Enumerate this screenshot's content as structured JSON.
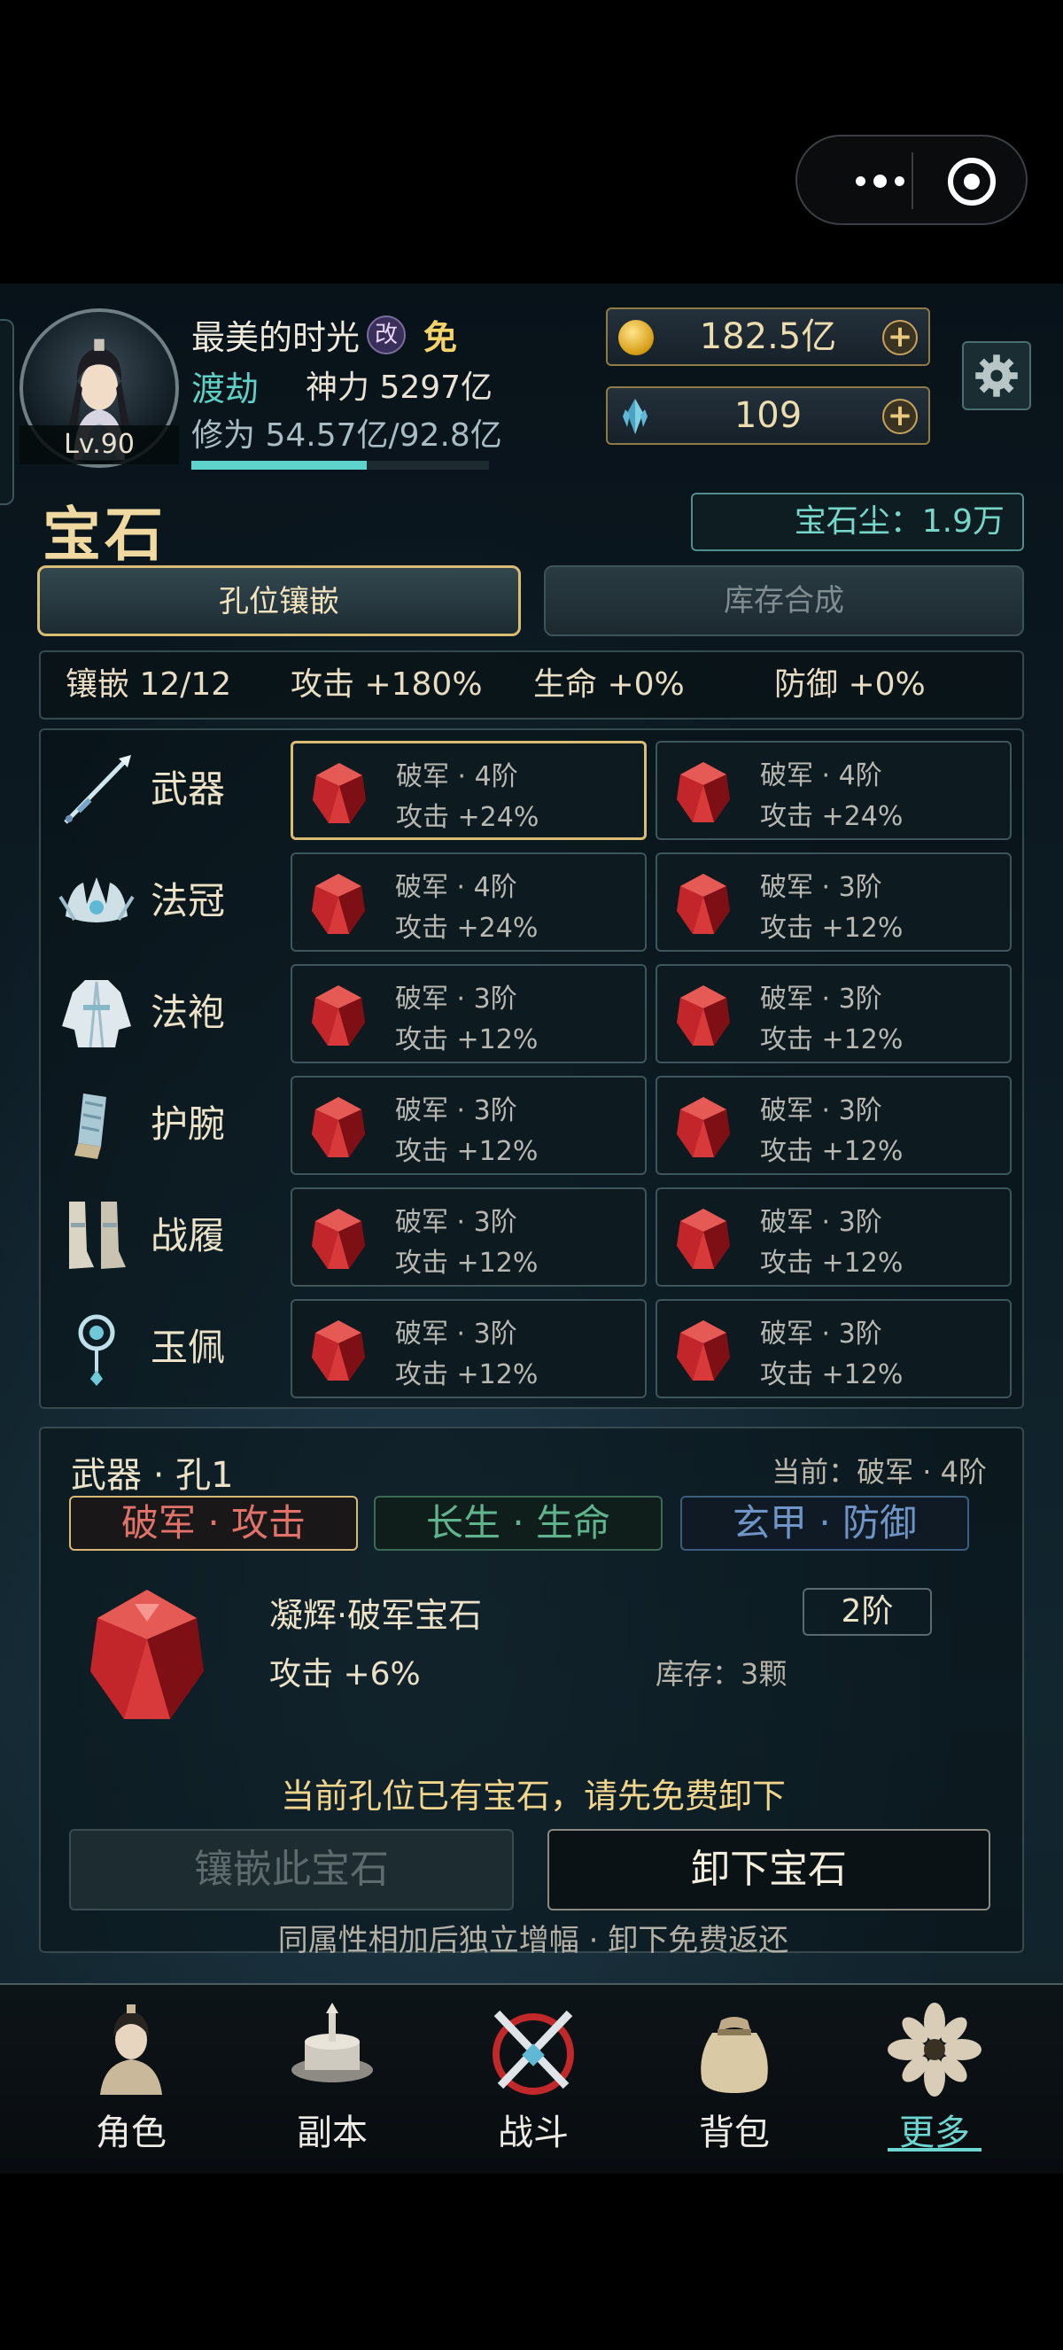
{
  "header": {
    "name": "最美的时光",
    "gai_badge": "改",
    "mian_badge": "免",
    "realm": "渡劫",
    "power": "神力 5297亿",
    "xiuwei": "修为 54.57亿/92.8亿",
    "xiuwei_progress": 0.588,
    "level": "Lv.90",
    "gold": "182.5亿",
    "crystal": "109",
    "plus": "+"
  },
  "page": {
    "title": "宝石",
    "dust": "宝石尘：1.9万"
  },
  "tabs": [
    {
      "label": "孔位镶嵌",
      "active": true
    },
    {
      "label": "库存合成",
      "active": false
    }
  ],
  "summary": {
    "inlay": "镶嵌 12/12",
    "attack": "攻击 +180%",
    "life": "生命 +0%",
    "defense": "防御 +0%"
  },
  "slots": [
    {
      "name": "武器",
      "icon": "sword-icon",
      "gems": [
        {
          "name": "破军 · 4阶",
          "stat": "攻击 +24%"
        },
        {
          "name": "破军 · 4阶",
          "stat": "攻击 +24%"
        }
      ]
    },
    {
      "name": "法冠",
      "icon": "crown-icon",
      "gems": [
        {
          "name": "破军 · 4阶",
          "stat": "攻击 +24%"
        },
        {
          "name": "破军 · 3阶",
          "stat": "攻击 +12%"
        }
      ]
    },
    {
      "name": "法袍",
      "icon": "robe-icon",
      "gems": [
        {
          "name": "破军 · 3阶",
          "stat": "攻击 +12%"
        },
        {
          "name": "破军 · 3阶",
          "stat": "攻击 +12%"
        }
      ]
    },
    {
      "name": "护腕",
      "icon": "bracer-icon",
      "gems": [
        {
          "name": "破军 · 3阶",
          "stat": "攻击 +12%"
        },
        {
          "name": "破军 · 3阶",
          "stat": "攻击 +12%"
        }
      ]
    },
    {
      "name": "战履",
      "icon": "boots-icon",
      "gems": [
        {
          "name": "破军 · 3阶",
          "stat": "攻击 +12%"
        },
        {
          "name": "破军 · 3阶",
          "stat": "攻击 +12%"
        }
      ]
    },
    {
      "name": "玉佩",
      "icon": "pendant-icon",
      "gems": [
        {
          "name": "破军 · 3阶",
          "stat": "攻击 +12%"
        },
        {
          "name": "破军 · 3阶",
          "stat": "攻击 +12%"
        }
      ]
    }
  ],
  "detail": {
    "title": "武器 · 孔1",
    "current": "当前：破军 · 4阶",
    "types": [
      "破军 · 攻击",
      "长生 · 生命",
      "玄甲 · 防御"
    ],
    "gem_name": "凝辉·破军宝石",
    "tier": "2阶",
    "stat": "攻击 +6%",
    "stock": "库存：3颗",
    "warning": "当前孔位已有宝石，请先免费卸下",
    "inlay_btn": "镶嵌此宝石",
    "remove_btn": "卸下宝石",
    "hint": "同属性相加后独立增幅 · 卸下免费返还"
  },
  "nav": [
    {
      "label": "角色",
      "icon": "character-icon"
    },
    {
      "label": "副本",
      "icon": "dungeon-icon"
    },
    {
      "label": "战斗",
      "icon": "battle-icon"
    },
    {
      "label": "背包",
      "icon": "bag-icon"
    },
    {
      "label": "更多",
      "icon": "more-icon",
      "active": true
    }
  ],
  "colors": {
    "accent_gold": "#d9bd74",
    "teal": "#6ed6d0",
    "gem_red": "#c8242a"
  }
}
